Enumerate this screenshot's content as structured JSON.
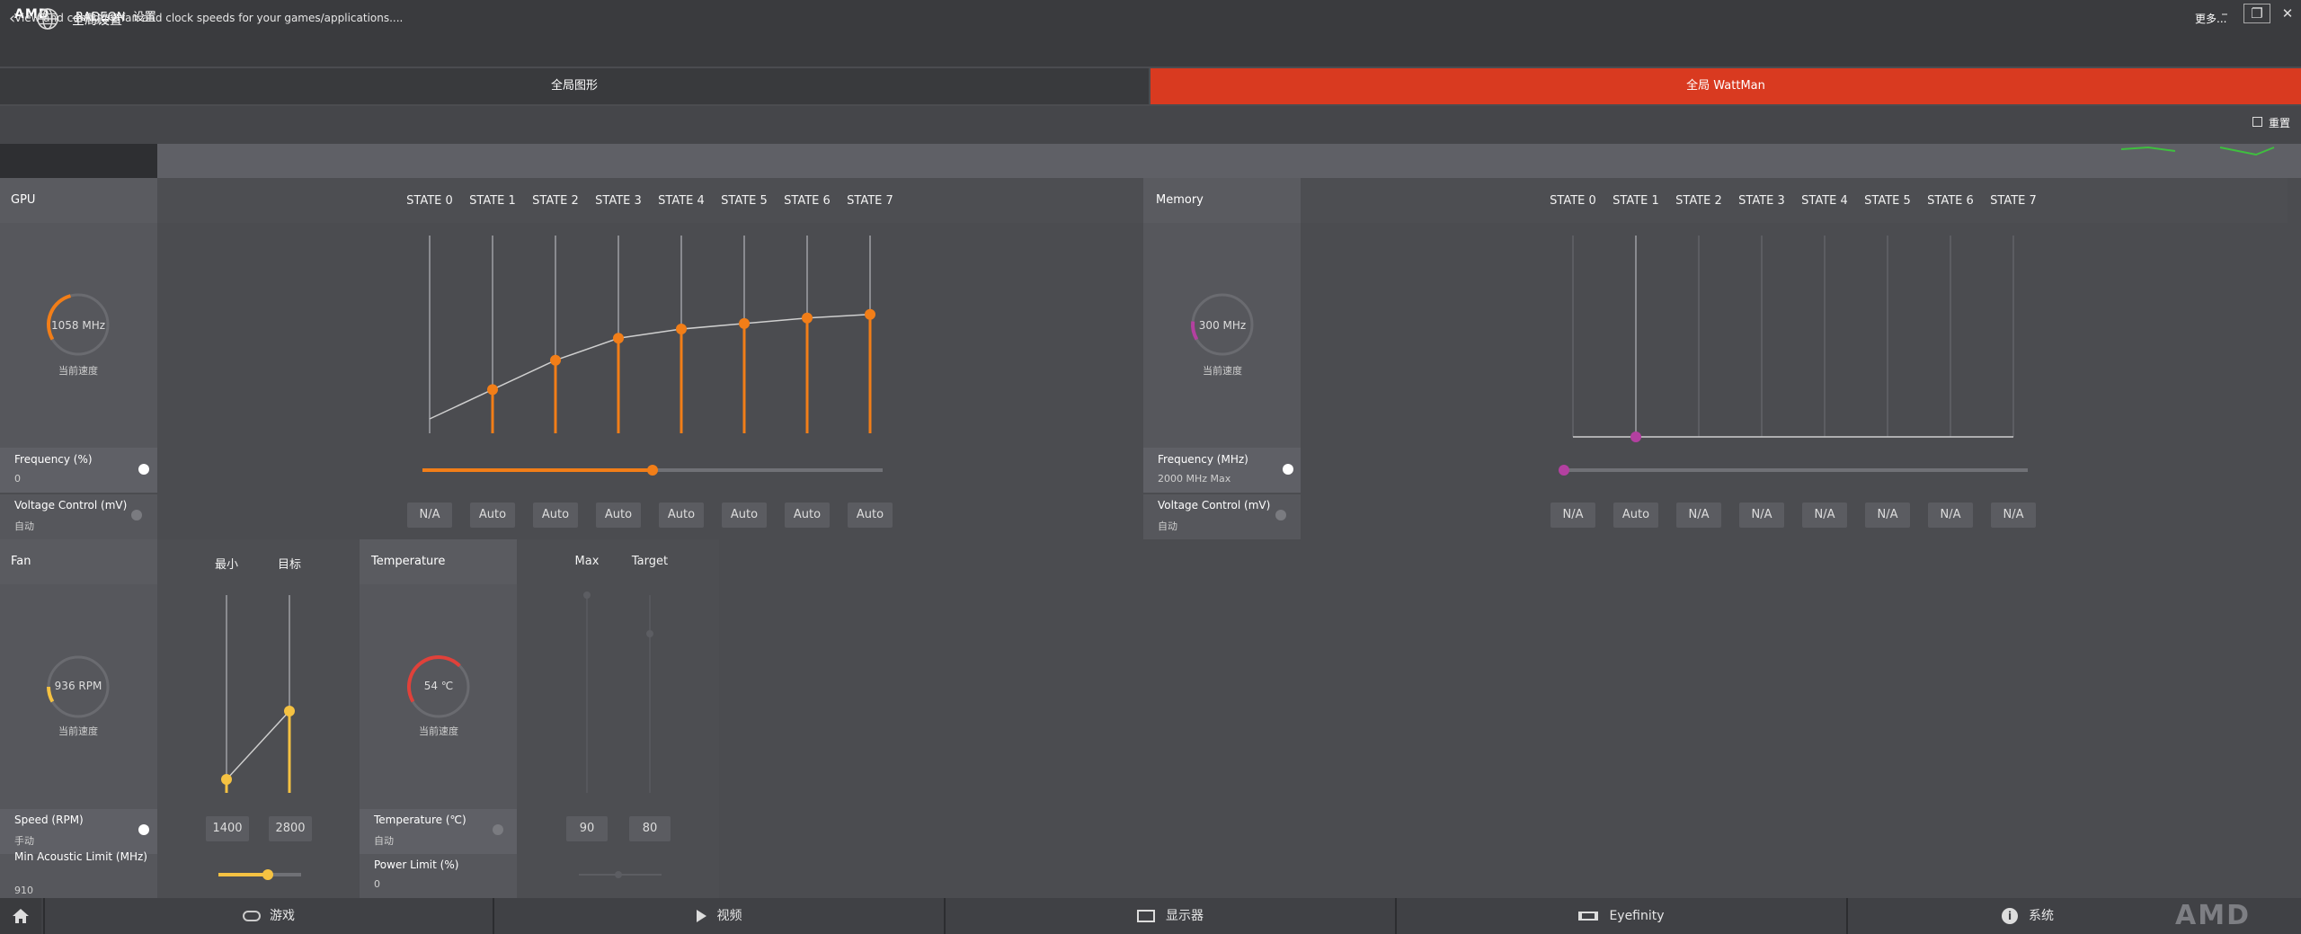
{
  "app": {
    "logo": "AMD",
    "brand": "RADEON",
    "settings": "设置",
    "subtitle": "全局设置"
  },
  "tabs": [
    {
      "label": "全局图形",
      "active": false
    },
    {
      "label": "全局 WattMan",
      "active": true
    }
  ],
  "description": "View and configure fan and clock speeds for your games/applications....",
  "toolbar": {
    "more": "更多...",
    "reset": "重置"
  },
  "gpu": {
    "title": "GPU",
    "gauge_value": "1058 MHz",
    "gauge_label": "当前速度",
    "gauge_fraction": 0.35,
    "states": [
      "STATE 0",
      "STATE 1",
      "STATE 2",
      "STATE 3",
      "STATE 4",
      "STATE 5",
      "STATE 6",
      "STATE 7"
    ],
    "frequency_label": "Frequency (%)",
    "frequency_value": "0",
    "voltage_label": "Voltage Control (mV)",
    "voltage_value": "自动",
    "voltage_buttons": [
      "N/A",
      "Auto",
      "Auto",
      "Auto",
      "Auto",
      "Auto",
      "Auto",
      "Auto"
    ],
    "curve": [
      0,
      0.16,
      0.32,
      0.44,
      0.49,
      0.52,
      0.55,
      0.57
    ],
    "slider_fraction": 0.5
  },
  "memory": {
    "title": "Memory",
    "gauge_value": "300 MHz",
    "gauge_label": "当前速度",
    "gauge_fraction": 0.12,
    "states": [
      "STATE 0",
      "STATE 1",
      "STATE 2",
      "STATE 3",
      "STATE 4",
      "STATE 5",
      "STATE 6",
      "STATE 7"
    ],
    "frequency_label": "Frequency (MHz)",
    "frequency_value": "2000 MHz Max",
    "voltage_label": "Voltage Control (mV)",
    "voltage_value": "自动",
    "voltage_buttons": [
      "N/A",
      "Auto",
      "N/A",
      "N/A",
      "N/A",
      "N/A",
      "N/A",
      "N/A"
    ],
    "slider_fraction": 0
  },
  "fan": {
    "title": "Fan",
    "col_min": "最小",
    "col_target": "目标",
    "gauge_value": "936 RPM",
    "gauge_label": "当前速度",
    "gauge_fraction": 0.1,
    "speed_label": "Speed (RPM)",
    "speed_value": "手动",
    "min_value": "1400",
    "target_value": "2800",
    "acoustic_label": "Min Acoustic Limit (MHz)",
    "acoustic_value": "910",
    "acoustic_fraction": 0.6
  },
  "temperature": {
    "title": "Temperature",
    "col_max": "Max",
    "col_target": "Target",
    "gauge_value": "54 ℃",
    "gauge_label": "当前速度",
    "gauge_fraction": 0.55,
    "temp_label": "Temperature (℃)",
    "temp_value": "自动",
    "max_value": "90",
    "target_value": "80",
    "power_label": "Power Limit (%)",
    "power_value": "0"
  },
  "nav": [
    {
      "label": "游戏",
      "icon": "gamepad-icon"
    },
    {
      "label": "视频",
      "icon": "play-icon"
    },
    {
      "label": "显示器",
      "icon": "monitor-icon"
    },
    {
      "label": "Eyefinity",
      "icon": "eyefinity-icon"
    },
    {
      "label": "系统",
      "icon": "info-icon"
    }
  ],
  "footer_logo": "AMD",
  "colors": {
    "accent": "#d93a20",
    "gpu": "#f27e18",
    "memory": "#b340a0",
    "fan": "#f5c242",
    "temperature": "#e0413a"
  }
}
